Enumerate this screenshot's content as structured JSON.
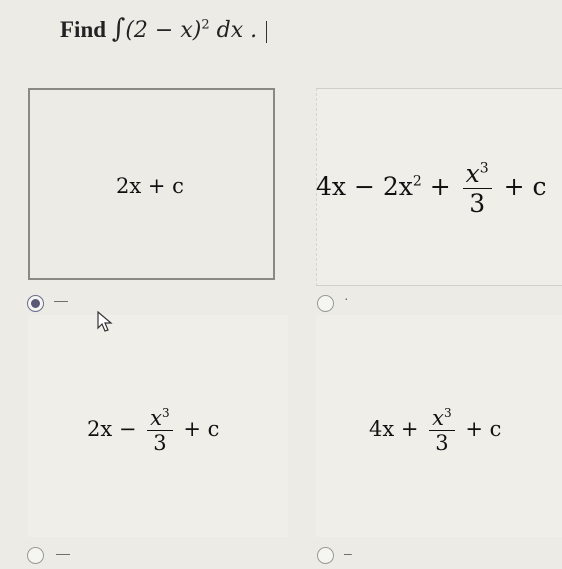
{
  "question": {
    "prefix": "Find",
    "integral_sign": "∫",
    "integrand": "(2 − x)",
    "power": "2",
    "differential": "dx ."
  },
  "options": [
    {
      "id": "a",
      "expr": "2x + c",
      "selected": true,
      "label": "—"
    },
    {
      "id": "b",
      "term1": "4x − 2x",
      "term1_power": "2",
      "plus": "+",
      "num": "x",
      "num_power": "3",
      "den": "3",
      "tail": "+ c",
      "selected": false,
      "label": "·"
    },
    {
      "id": "c",
      "term1": "2x −",
      "num": "x",
      "num_power": "3",
      "den": "3",
      "tail": "+ c",
      "selected": false,
      "label": "—"
    },
    {
      "id": "d",
      "term1": "4x +",
      "num": "x",
      "num_power": "3",
      "den": "3",
      "tail": "+ c",
      "selected": false,
      "label": "–"
    }
  ]
}
